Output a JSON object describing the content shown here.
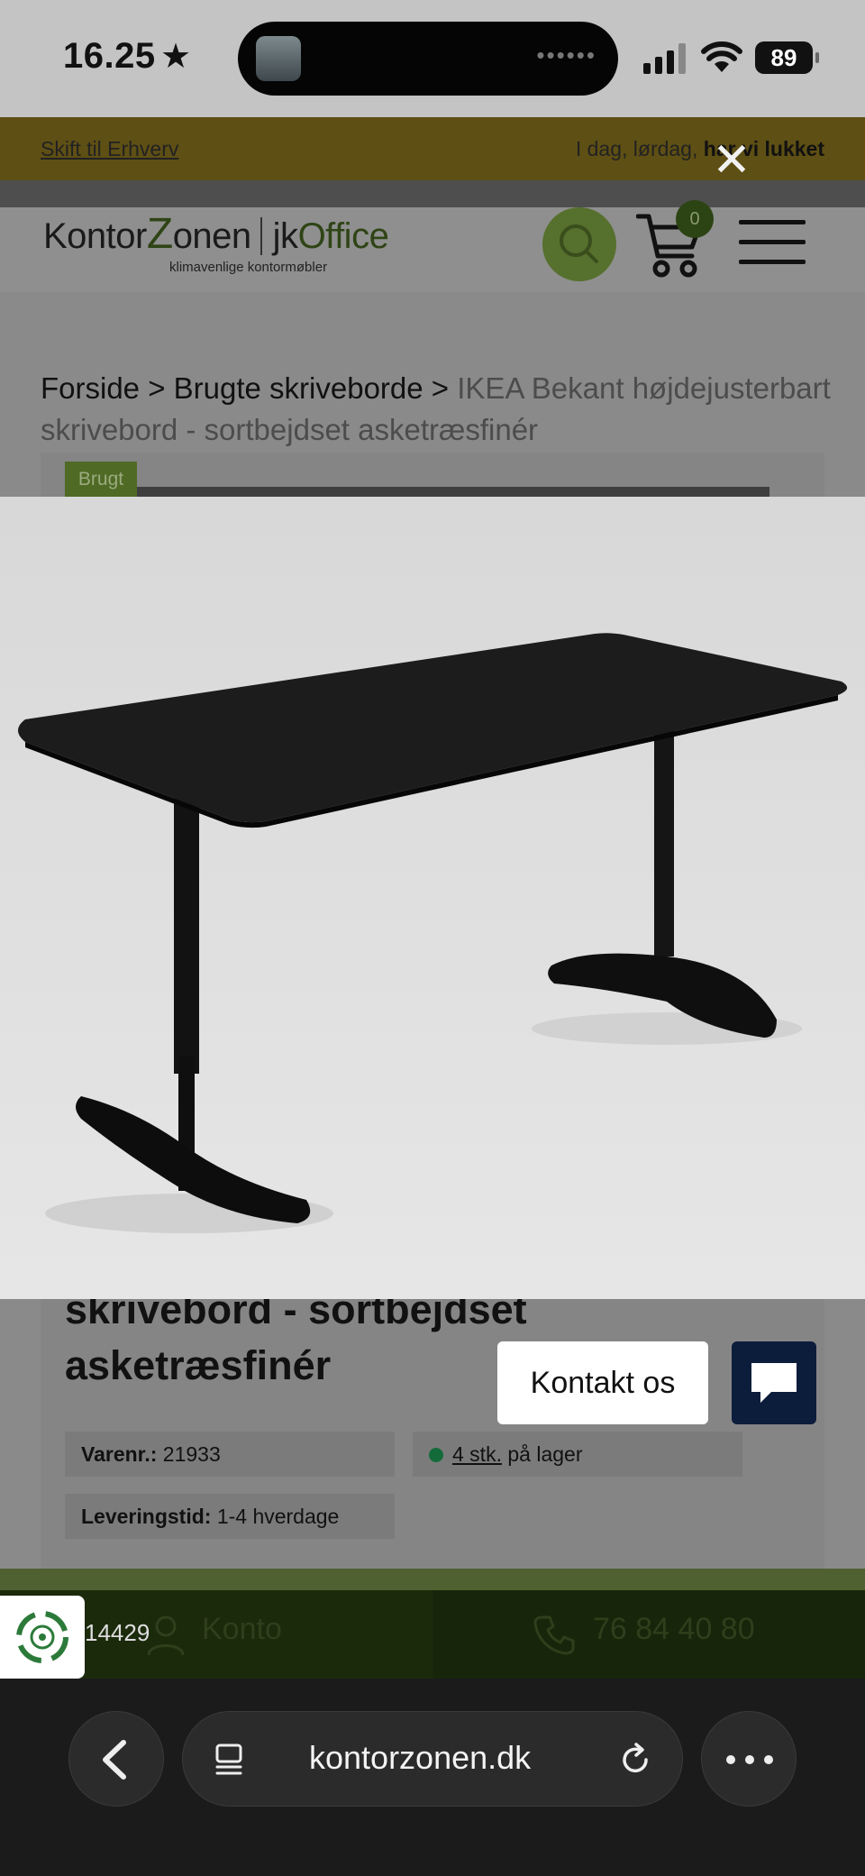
{
  "status_bar": {
    "time": "16.25",
    "battery": "89",
    "island_dots": "••••••"
  },
  "banner": {
    "left_link": "Skift til Erhverv",
    "right_text_prefix": "I dag, lørdag, ",
    "right_text_bold": "har vi lukket"
  },
  "overlay": {
    "close_icon": "close-icon"
  },
  "logo": {
    "part1": "Kontor",
    "part2": "Z",
    "part3": "onen",
    "part4": "jk",
    "part5": "Office",
    "tagline": "klimavenlige kontormøbler"
  },
  "cart": {
    "count": "0"
  },
  "breadcrumb": {
    "item1": "Forside",
    "sep": " > ",
    "item2": "Brugte skriveborde",
    "current": "IKEA Bekant højdejusterbart skrivebord - sortbejdset asketræsfinér"
  },
  "product": {
    "badge": "Brugt",
    "title_line1": "skrivebord - sortbejdset",
    "title_line2": "asketræsfinér",
    "sku_label": "Varenr.:",
    "sku_value": "21933",
    "stock_link": "4 stk.",
    "stock_text": "på lager",
    "delivery_label": "Leveringstid:",
    "delivery_value": "1-4 hverdage"
  },
  "contact": {
    "label": "Kontakt os"
  },
  "bottom_nav": {
    "left_number": "14429",
    "account": "Konto",
    "phone": "76 84 40 80"
  },
  "browser": {
    "url": "kontorzonen.dk"
  },
  "colors": {
    "brand_green": "#2f4416",
    "chat_navy": "#0c1c3b",
    "stock_green": "#136b3a"
  }
}
